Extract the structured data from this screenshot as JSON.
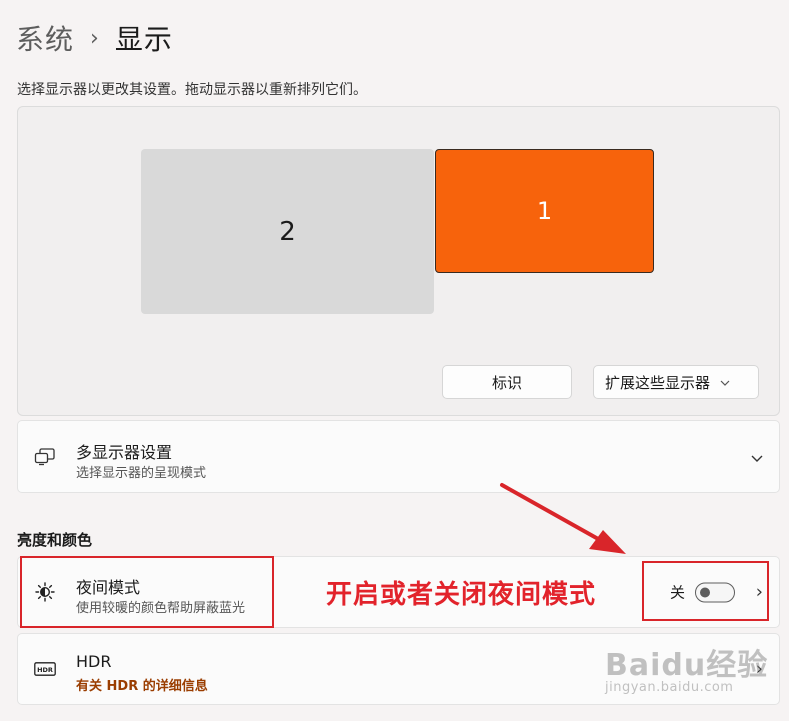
{
  "breadcrumb": {
    "parent": "系统",
    "separator": "›",
    "current": "显示"
  },
  "description": "选择显示器以更改其设置。拖动显示器以重新排列它们。",
  "monitors": [
    {
      "label": "2",
      "primary": false,
      "color": "#d9d9d9"
    },
    {
      "label": "1",
      "primary": true,
      "color": "#f7630c"
    }
  ],
  "buttons": {
    "identify": "标识",
    "extend": "扩展这些显示器",
    "extend_chevron": "⌄"
  },
  "multi_display": {
    "title": "多显示器设置",
    "subtitle": "选择显示器的呈现模式"
  },
  "section_brightness": "亮度和颜色",
  "night_light": {
    "title": "夜间模式",
    "subtitle": "使用较暖的颜色帮助屏蔽蓝光",
    "state_label": "关",
    "enabled": false
  },
  "hdr": {
    "title": "HDR",
    "subtitle": "有关 HDR 的详细信息",
    "icon_text": "HDR"
  },
  "annotation": {
    "text": "开启或者关闭夜间模式",
    "color": "#e2232b"
  },
  "watermark": {
    "main": "Baidu经验",
    "sub": "jingyan.baidu.com"
  },
  "chevron_right": "›"
}
